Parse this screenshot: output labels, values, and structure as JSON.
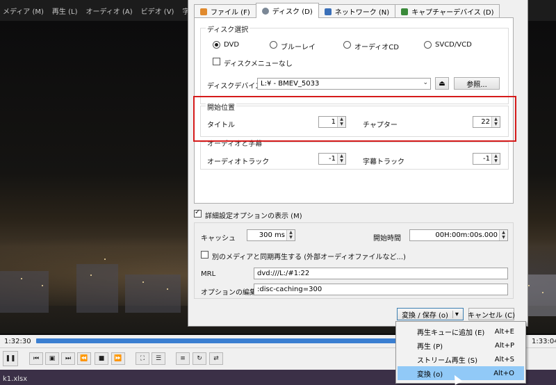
{
  "menubar": [
    "メディア (M)",
    "再生 (L)",
    "オーディオ (A)",
    "ビデオ (V)",
    "字幕 (T)"
  ],
  "tabs": [
    {
      "label": "ファイル (F)",
      "color": "#e08a2e"
    },
    {
      "label": "ディスク (D)",
      "color": "#7b8896"
    },
    {
      "label": "ネットワーク (N)",
      "color": "#3a6fb8"
    },
    {
      "label": "キャプチャーデバイス (D)",
      "color": "#3a8a3a"
    }
  ],
  "disc": {
    "group_title": "ディスク選択",
    "radios": [
      "DVD",
      "ブルーレイ",
      "オーディオCD",
      "SVCD/VCD"
    ],
    "no_menu": "ディスクメニューなし",
    "device_label": "ディスクデバイス",
    "device_value": "L:¥ - BMEV_5033",
    "browse": "参照..."
  },
  "start": {
    "group_title": "開始位置",
    "title_label": "タイトル",
    "title_value": "1",
    "chapter_label": "チャプター",
    "chapter_value": "22"
  },
  "audio_sub": {
    "group_title": "オーディオと字幕",
    "audio_label": "オーディオトラック",
    "audio_value": "-1",
    "sub_label": "字幕トラック",
    "sub_value": "-1"
  },
  "advanced": {
    "show_options": "詳細設定オプションの表示 (M)",
    "cache_label": "キャッシュ",
    "cache_value": "300 ms",
    "start_time_label": "開始時間",
    "start_time_value": "00H:00m:00s.000",
    "sync_play": "別のメディアと同期再生する (外部オーディオファイルなど...)",
    "mrl_label": "MRL",
    "mrl_value": "dvd:///L:/#1:22",
    "opt_label": "オプションの編集",
    "opt_value": ":disc-caching=300"
  },
  "buttons": {
    "convert": "変換 / 保存 (o)",
    "cancel": "キャンセル (C)"
  },
  "dropdown": [
    {
      "label": "再生キューに追加 (E)",
      "shortcut": "Alt+E"
    },
    {
      "label": "再生 (P)",
      "shortcut": "Alt+P"
    },
    {
      "label": "ストリーム再生 (S)",
      "shortcut": "Alt+S"
    },
    {
      "label": "変換 (o)",
      "shortcut": "Alt+O"
    }
  ],
  "player": {
    "time_elapsed": "1:32:30",
    "time_total": "1:33:04",
    "status_file": "k1.xlsx"
  },
  "colors": {
    "accent": "#3b7fd1",
    "highlight": "#91c9f7",
    "annotation_red": "#d51a1a"
  }
}
